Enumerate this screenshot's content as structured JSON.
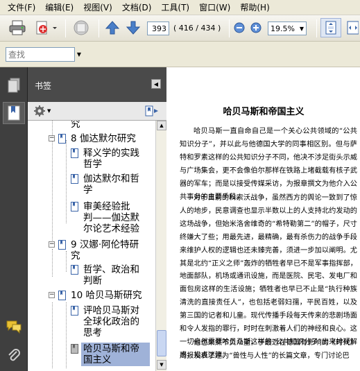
{
  "menu": [
    "文件(F)",
    "编辑(E)",
    "视图(V)",
    "文档(D)",
    "工具(T)",
    "窗口(W)",
    "帮助(H)"
  ],
  "toolbar": {
    "page_number": "393",
    "page_count": "( 416 / 434 )",
    "zoom": "19.5%"
  },
  "find": {
    "placeholder": "查找"
  },
  "bookmarks": {
    "title": "书签",
    "items": [
      {
        "label": "究",
        "level": 2,
        "type": "page"
      },
      {
        "label": "8  伽达默尔研究",
        "level": 1,
        "type": "chapter"
      },
      {
        "label": "释义学的实践哲学",
        "level": 2,
        "type": "page"
      },
      {
        "label": "伽达默尔和哲学",
        "level": 2,
        "type": "page"
      },
      {
        "label": "审美经验批判——伽达默尔论艺术经验",
        "level": 2,
        "type": "page"
      },
      {
        "label": "9  汉娜·阿伦特研究",
        "level": 1,
        "type": "chapter"
      },
      {
        "label": "哲学、政治和判断",
        "level": 2,
        "type": "page"
      },
      {
        "label": "10  哈贝马斯研究",
        "level": 1,
        "type": "chapter"
      },
      {
        "label": "评哈贝马斯对全球化政治的思考",
        "level": 2,
        "type": "page"
      },
      {
        "label": "哈贝马斯和帝国主义",
        "level": 2,
        "type": "page",
        "selected": true
      }
    ],
    "lines": {
      "item0": "究",
      "item1": "8  伽达默尔研究",
      "item2a": "释义学的实践",
      "item2b": "哲学",
      "item3a": "伽达默尔和哲",
      "item3b": "学",
      "item4a": "审美经验批",
      "item4b": "判——伽达默",
      "item4c": "尔论艺术经验",
      "item5a": "9  汉娜·阿伦特研",
      "item5b": "究",
      "item6a": "哲学、政治和",
      "item6b": "判断",
      "item7": "10  哈贝马斯研究",
      "item8a": "评哈贝马斯对",
      "item8b": "全球化政治的",
      "item8c": "思考",
      "item9a": "哈贝马斯和帝",
      "item9b": "国主义"
    }
  },
  "document": {
    "title": "哈贝马斯和帝国主义",
    "paragraphs": [
      "哈贝马斯一直自命自己是一个关心公共领域的“公共知识分子”，并以此与他德国大学的同事相区别。但与萨特和罗素这样的公共知识分子不同，他决不涉足街头示威与广场集会，更不会像伯尔那样在铁路上堵截载有核子武器的军车；而是以接受传媒采访，为报章撰文为他介入公共事务的主要手段。",
      "对于目前的科索沃战争，虽然西方的舆论一致到了惊人的地步，民意调查也显示半数以上的人支持北约发动的这场战争，但始米洛舍维奇的“希特勒第二”的帽子，尺寸终嫌大了些；用最先进，最精确，最有杀伤力的战争手段来维护人权的逻辑也还未臻完善，须进一步加以阐明。尤其是北约“正义之师”轰炸的牺牲者早已不是军事指挥部，地面部队，机场或通讯设施，而是医院、民宅、发电厂和面包房这样的生活设施；牺牲者也早已不止是“执行种族清洗的直接责任人”，也包括老弱妇孺，平民百姓，以及第三国的记者和儿童。现代传播手段每天传来的悲剧场面和令人发指的罪行，时时在刺激着人们的神经和良心。这一切自然需要哈贝马斯这样的“公共知识分子”出来排疑解惑，指点迷津。",
      "他也果然不负众望，于最近在德国有影响的《时代》周报发表了题为“兽性与人性”的长篇文章，专门讨论巴"
    ]
  },
  "colors": {
    "nav_panel": "#3f3f3f",
    "bookmark_header": "#4a4a4a",
    "selection": "#9fb2d8",
    "toolbar_bg": "#ece9d8"
  }
}
